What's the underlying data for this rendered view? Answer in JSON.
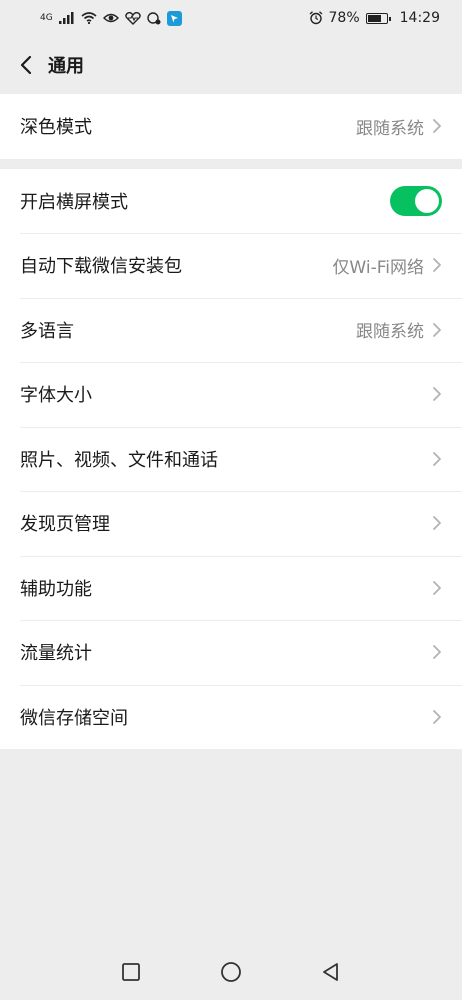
{
  "status": {
    "network": "4G",
    "battery": "78%",
    "battery_level": 0.78,
    "time": "14:29"
  },
  "header": {
    "title": "通用"
  },
  "groups": [
    {
      "rows": [
        {
          "label": "深色模式",
          "value": "跟随系统"
        }
      ]
    },
    {
      "rows": [
        {
          "label": "开启横屏模式",
          "toggle": true
        },
        {
          "label": "自动下载微信安装包",
          "value": "仅Wi-Fi网络"
        },
        {
          "label": "多语言",
          "value": "跟随系统"
        },
        {
          "label": "字体大小",
          "value": ""
        },
        {
          "label": "照片、视频、文件和通话",
          "value": ""
        },
        {
          "label": "发现页管理",
          "value": ""
        },
        {
          "label": "辅助功能",
          "value": ""
        },
        {
          "label": "流量统计",
          "value": ""
        },
        {
          "label": "微信存储空间",
          "value": ""
        }
      ]
    }
  ],
  "colors": {
    "accent": "#07c160",
    "background": "#ededed"
  },
  "icons": [
    "signal-icon",
    "wifi-icon",
    "eye-icon",
    "heart-icon",
    "chat-icon",
    "app-icon",
    "alarm-icon",
    "battery-icon",
    "back-icon",
    "chevron-right-icon",
    "nav-recent-icon",
    "nav-home-icon",
    "nav-back-icon"
  ]
}
